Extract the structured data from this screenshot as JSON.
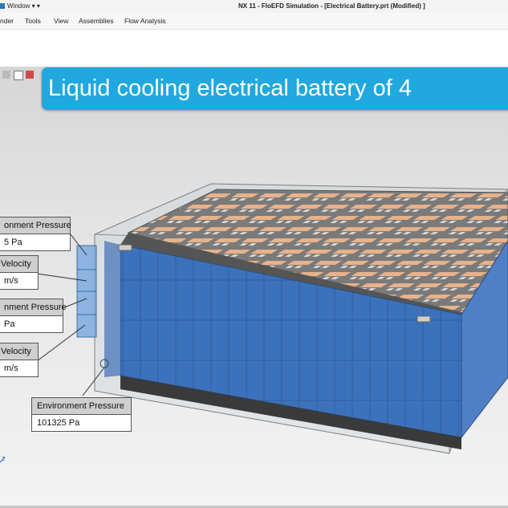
{
  "titlebar": {
    "window_menu": "Window ▾ ▾",
    "title": "NX 11 - FloEFD Simulation - [Electrical Battery.prt (Modified) ]"
  },
  "menu": {
    "items": [
      "nder",
      "Tools",
      "View",
      "Assemblies",
      "Flow Analysis"
    ]
  },
  "banner": {
    "text": "Liquid cooling electrical battery of 4"
  },
  "callouts": [
    {
      "header": "onment Pressure",
      "value": "5 Pa"
    },
    {
      "header": "Velocity",
      "value": "m/s"
    },
    {
      "header": "nment Pressure",
      "value": "Pa"
    },
    {
      "header": "Velocity",
      "value": "m/s"
    },
    {
      "header": "Environment Pressure",
      "value": "101325 Pa"
    }
  ],
  "triad": {
    "label": "Z"
  },
  "colors": {
    "banner": "#20a8df",
    "battery_cells": "#3a6fb8",
    "busbar": "#e8b28a",
    "module_top": "#6e6e6e"
  }
}
